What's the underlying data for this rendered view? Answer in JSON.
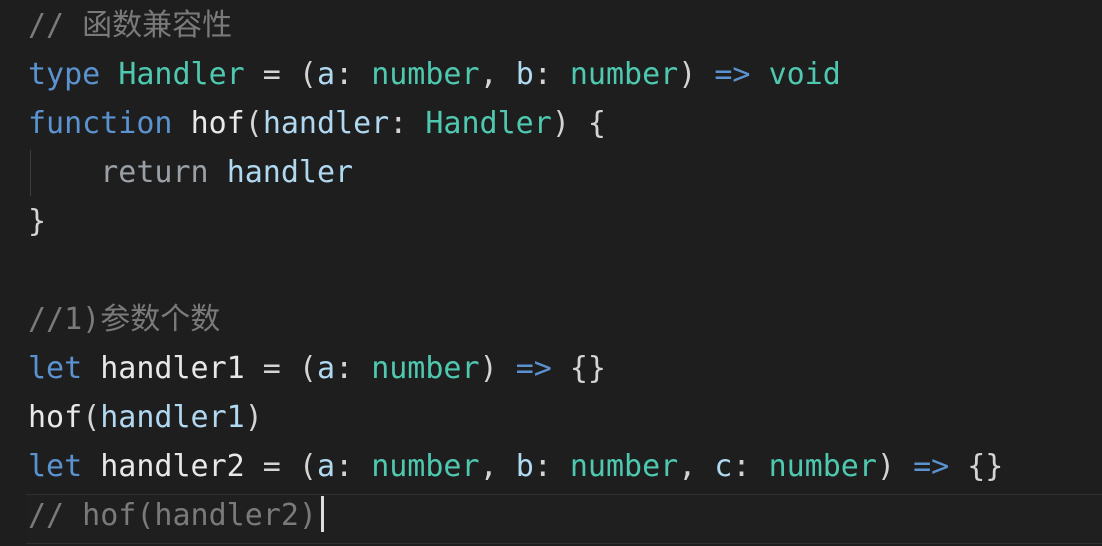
{
  "editor": {
    "lines": [
      {
        "tokens": [
          {
            "text": "// 函数兼容性",
            "cls": "cmt"
          }
        ]
      },
      {
        "tokens": [
          {
            "text": "type",
            "cls": "kw"
          },
          {
            "text": " ",
            "cls": "pun"
          },
          {
            "text": "Handler",
            "cls": "typ"
          },
          {
            "text": " = (",
            "cls": "pun"
          },
          {
            "text": "a",
            "cls": "par"
          },
          {
            "text": ": ",
            "cls": "pun"
          },
          {
            "text": "number",
            "cls": "typ"
          },
          {
            "text": ", ",
            "cls": "pun"
          },
          {
            "text": "b",
            "cls": "par"
          },
          {
            "text": ": ",
            "cls": "pun"
          },
          {
            "text": "number",
            "cls": "typ"
          },
          {
            "text": ") ",
            "cls": "pun"
          },
          {
            "text": "=>",
            "cls": "kw"
          },
          {
            "text": " ",
            "cls": "pun"
          },
          {
            "text": "void",
            "cls": "typ"
          }
        ]
      },
      {
        "tokens": [
          {
            "text": "function",
            "cls": "kw"
          },
          {
            "text": " ",
            "cls": "pun"
          },
          {
            "text": "hof",
            "cls": "fn"
          },
          {
            "text": "(",
            "cls": "pun"
          },
          {
            "text": "handler",
            "cls": "par"
          },
          {
            "text": ": ",
            "cls": "pun"
          },
          {
            "text": "Handler",
            "cls": "typ"
          },
          {
            "text": ") {",
            "cls": "pun"
          }
        ]
      },
      {
        "tokens": [
          {
            "text": "    ",
            "cls": "pun"
          },
          {
            "text": "return",
            "cls": "ret"
          },
          {
            "text": " ",
            "cls": "pun"
          },
          {
            "text": "handler",
            "cls": "par"
          }
        ]
      },
      {
        "tokens": [
          {
            "text": "}",
            "cls": "pun"
          }
        ]
      },
      {
        "tokens": []
      },
      {
        "tokens": [
          {
            "text": "//1)参数个数",
            "cls": "cmt"
          }
        ]
      },
      {
        "tokens": [
          {
            "text": "let",
            "cls": "kw"
          },
          {
            "text": " ",
            "cls": "pun"
          },
          {
            "text": "handler1",
            "cls": "fn"
          },
          {
            "text": " = (",
            "cls": "pun"
          },
          {
            "text": "a",
            "cls": "par"
          },
          {
            "text": ": ",
            "cls": "pun"
          },
          {
            "text": "number",
            "cls": "typ"
          },
          {
            "text": ") ",
            "cls": "pun"
          },
          {
            "text": "=>",
            "cls": "kw"
          },
          {
            "text": " {}",
            "cls": "pun"
          }
        ]
      },
      {
        "tokens": [
          {
            "text": "hof",
            "cls": "fn"
          },
          {
            "text": "(",
            "cls": "pun"
          },
          {
            "text": "handler1",
            "cls": "par"
          },
          {
            "text": ")",
            "cls": "pun"
          }
        ]
      },
      {
        "tokens": [
          {
            "text": "let",
            "cls": "kw"
          },
          {
            "text": " ",
            "cls": "pun"
          },
          {
            "text": "handler2",
            "cls": "fn"
          },
          {
            "text": " = (",
            "cls": "pun"
          },
          {
            "text": "a",
            "cls": "par"
          },
          {
            "text": ": ",
            "cls": "pun"
          },
          {
            "text": "number",
            "cls": "typ"
          },
          {
            "text": ", ",
            "cls": "pun"
          },
          {
            "text": "b",
            "cls": "par"
          },
          {
            "text": ": ",
            "cls": "pun"
          },
          {
            "text": "number",
            "cls": "typ"
          },
          {
            "text": ", ",
            "cls": "pun"
          },
          {
            "text": "c",
            "cls": "par"
          },
          {
            "text": ": ",
            "cls": "pun"
          },
          {
            "text": "number",
            "cls": "typ"
          },
          {
            "text": ") ",
            "cls": "pun"
          },
          {
            "text": "=>",
            "cls": "kw"
          },
          {
            "text": " {}",
            "cls": "pun"
          }
        ]
      },
      {
        "tokens": [
          {
            "text": "// hof(handler2)",
            "cls": "cmt"
          }
        ]
      }
    ],
    "colors": {
      "background": "#1e1e1e",
      "comment": "#7a7a7a",
      "keyword": "#5b93d0",
      "type": "#4ec9b0",
      "function": "#e8e8e8",
      "parameter": "#b0d8f0",
      "punctuation": "#d4d4d4"
    }
  }
}
